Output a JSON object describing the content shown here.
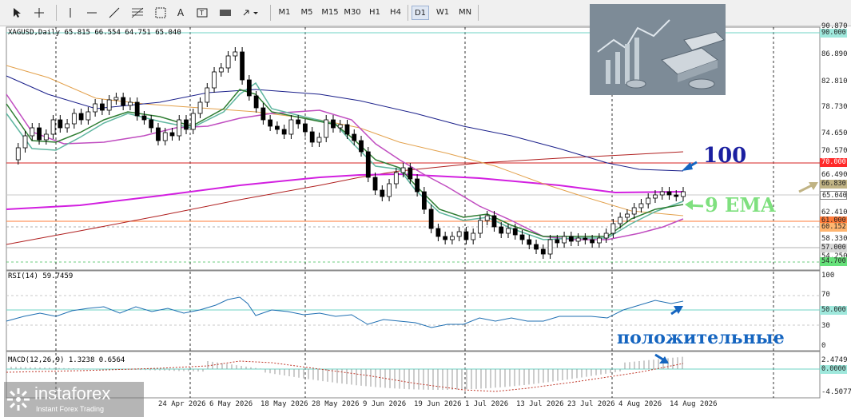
{
  "toolbar": {
    "timeframes": [
      "M1",
      "M5",
      "M15",
      "M30",
      "H1",
      "H4",
      "D1",
      "W1",
      "MN"
    ],
    "active_timeframe": "D1",
    "text_tool": "A"
  },
  "chart": {
    "symbol_header": "XAGUSD,Daily  65.815 66.554 64.751 65.040",
    "price_axis": [
      "90.870",
      "86.890",
      "82.810",
      "78.730",
      "74.650",
      "70.570",
      "66.490",
      "62.410",
      "58.330",
      "54.250"
    ],
    "tags": [
      {
        "text": "90.000",
        "bg": "#9fe8dc"
      },
      {
        "text": "70.000",
        "bg": "#ff2a2a"
      },
      {
        "text": "66.830",
        "bg": "#c0b384"
      },
      {
        "text": "65.040",
        "bg": "#ffffff"
      },
      {
        "text": "61.000",
        "bg": "#ff7b3a"
      },
      {
        "text": "60.152",
        "bg": "#ffb570"
      },
      {
        "text": "57.000",
        "bg": "#d8d8d8"
      },
      {
        "text": "54.700",
        "bg": "#66e17a"
      }
    ],
    "dates": [
      "24 Apr 2026",
      "6 May 2026",
      "18 May 2026",
      "28 May 2026",
      "9 Jun 2026",
      "19 Jun 2026",
      "1 Jul 2026",
      "13 Jul 2026",
      "23 Jul 2026",
      "4 Aug 2026",
      "14 Aug 2026"
    ]
  },
  "rsi": {
    "title": "RSI(14) 59.7459",
    "levels": [
      "100",
      "70",
      "50.000",
      "30",
      "0"
    ]
  },
  "macd": {
    "title": "MACD(12,26,9) 1.3238 0.6564",
    "levels": [
      "2.4749",
      "0.0000",
      "-4.5077"
    ]
  },
  "annotations": {
    "label_100": "100",
    "label_ema": "9 EMA",
    "label_positive": "положительные"
  },
  "watermark": {
    "brand": "instaforex",
    "tagline": "Instant Forex Trading"
  },
  "colors": {
    "ma100": "#1a1f8a",
    "ema9": "#2e7d32",
    "ema_light": "#5fb6a0",
    "purple_ma": "#c04dc0",
    "magenta_ma": "#d21fe0",
    "orange_ma": "#e3a14c",
    "red_ma": "#b02020",
    "rsi_line": "#1f6fb2",
    "annotation_blue": "#1565c0",
    "annotation_green": "#7fe07f"
  }
}
